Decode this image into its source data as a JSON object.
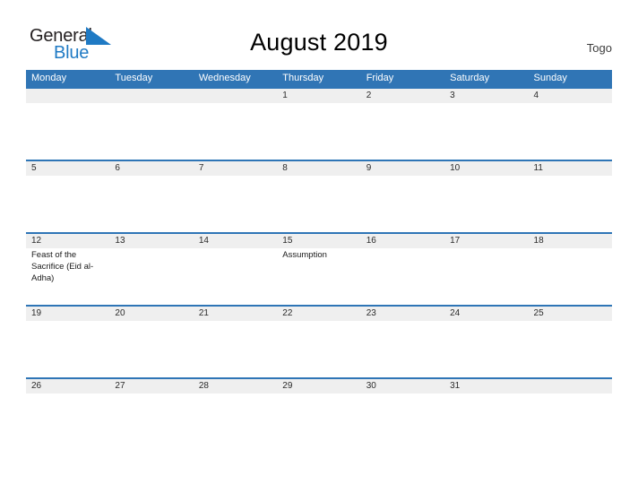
{
  "brand": {
    "name_part1": "General",
    "name_part2": "Blue",
    "flag_icon": "blue-triangle-flag-icon",
    "primary_color": "#1f7ac4",
    "text_color": "#231f20"
  },
  "header": {
    "title": "August 2019",
    "country": "Togo",
    "header_bg_color": "#3075b5",
    "band_color": "#efefef",
    "rule_color": "#2e75b6"
  },
  "weekdays": [
    "Monday",
    "Tuesday",
    "Wednesday",
    "Thursday",
    "Friday",
    "Saturday",
    "Sunday"
  ],
  "weeks": [
    {
      "days": [
        {
          "num": "",
          "events": []
        },
        {
          "num": "",
          "events": []
        },
        {
          "num": "",
          "events": []
        },
        {
          "num": "1",
          "events": []
        },
        {
          "num": "2",
          "events": []
        },
        {
          "num": "3",
          "events": []
        },
        {
          "num": "4",
          "events": []
        }
      ]
    },
    {
      "days": [
        {
          "num": "5",
          "events": []
        },
        {
          "num": "6",
          "events": []
        },
        {
          "num": "7",
          "events": []
        },
        {
          "num": "8",
          "events": []
        },
        {
          "num": "9",
          "events": []
        },
        {
          "num": "10",
          "events": []
        },
        {
          "num": "11",
          "events": []
        }
      ]
    },
    {
      "days": [
        {
          "num": "12",
          "events": [
            "Feast of the Sacrifice (Eid al-Adha)"
          ]
        },
        {
          "num": "13",
          "events": []
        },
        {
          "num": "14",
          "events": []
        },
        {
          "num": "15",
          "events": [
            "Assumption"
          ]
        },
        {
          "num": "16",
          "events": []
        },
        {
          "num": "17",
          "events": []
        },
        {
          "num": "18",
          "events": []
        }
      ]
    },
    {
      "days": [
        {
          "num": "19",
          "events": []
        },
        {
          "num": "20",
          "events": []
        },
        {
          "num": "21",
          "events": []
        },
        {
          "num": "22",
          "events": []
        },
        {
          "num": "23",
          "events": []
        },
        {
          "num": "24",
          "events": []
        },
        {
          "num": "25",
          "events": []
        }
      ]
    },
    {
      "days": [
        {
          "num": "26",
          "events": []
        },
        {
          "num": "27",
          "events": []
        },
        {
          "num": "28",
          "events": []
        },
        {
          "num": "29",
          "events": []
        },
        {
          "num": "30",
          "events": []
        },
        {
          "num": "31",
          "events": []
        },
        {
          "num": "",
          "events": []
        }
      ]
    }
  ]
}
